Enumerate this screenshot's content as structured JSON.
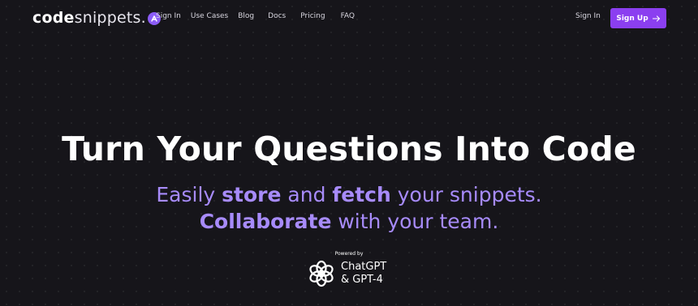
{
  "brand": {
    "name_bold": "code",
    "name_light": "snippets",
    "dot": "."
  },
  "nav": {
    "links": [
      "Sign In",
      "Use Cases",
      "Blog",
      "Docs",
      "Pricing",
      "FAQ"
    ],
    "sign_in": "Sign In",
    "sign_up": "Sign Up",
    "sign_up_arrow": "→"
  },
  "hero": {
    "title": "Turn Your Questions Into Code",
    "line1": {
      "a": "Easily ",
      "b": "store",
      "c": " and ",
      "d": "fetch",
      "e": " your snippets."
    },
    "line2": {
      "a": "Collaborate",
      "b": " with your team."
    },
    "powered_by": "Powered by",
    "gpt_line1": "ChatGPT",
    "gpt_line2": "& GPT-4"
  },
  "colors": {
    "accent": "#8b3ff0",
    "tagline": "#a78bfa",
    "background": "#16151a"
  },
  "icons": {
    "logo_mark": "logo-a-icon",
    "arrow": "arrow-right-icon",
    "openai": "openai-logo-icon"
  }
}
